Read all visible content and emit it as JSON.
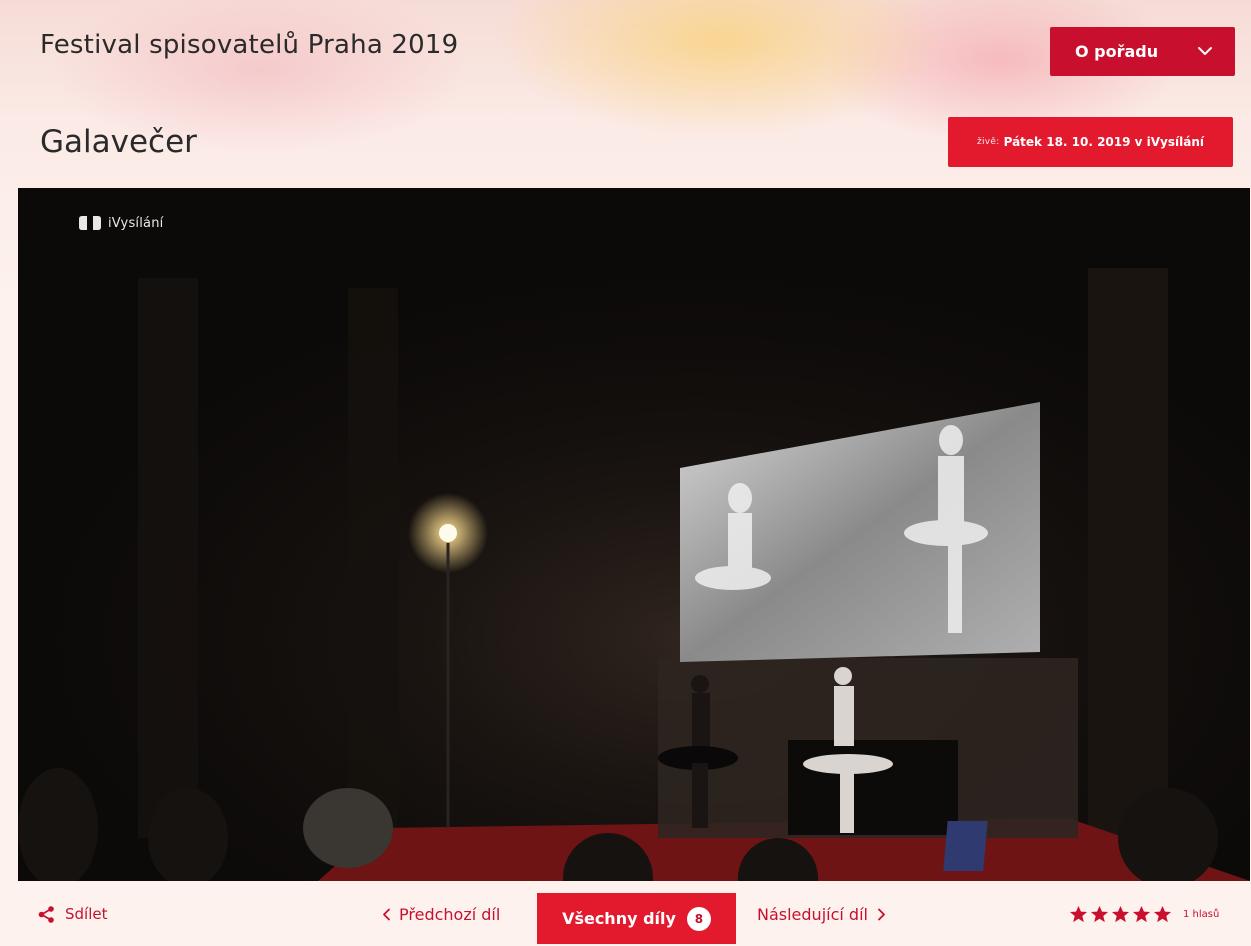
{
  "header": {
    "show_title": "Festival spisovatelů Praha 2019",
    "about_button": "O pořadu",
    "episode_title": "Galavečer",
    "live_prefix": "živě:",
    "live_text": "Pátek 18. 10. 2019 v iVysílání"
  },
  "player": {
    "logo_text": "iVysílání"
  },
  "controls": {
    "share_label": "Sdílet",
    "prev_label": "Předchozí díl",
    "all_label": "Všechny díly",
    "all_count": "8",
    "next_label": "Následující díl",
    "rating_stars": 5,
    "votes_label": "1 hlasů"
  },
  "colors": {
    "accent": "#e3192e",
    "accent_dark": "#c8102e"
  },
  "icons": {
    "about_chevron": "chevron-down-icon",
    "share": "share-icon",
    "prev": "chevron-left-icon",
    "next": "chevron-right-icon",
    "star": "star-icon"
  }
}
